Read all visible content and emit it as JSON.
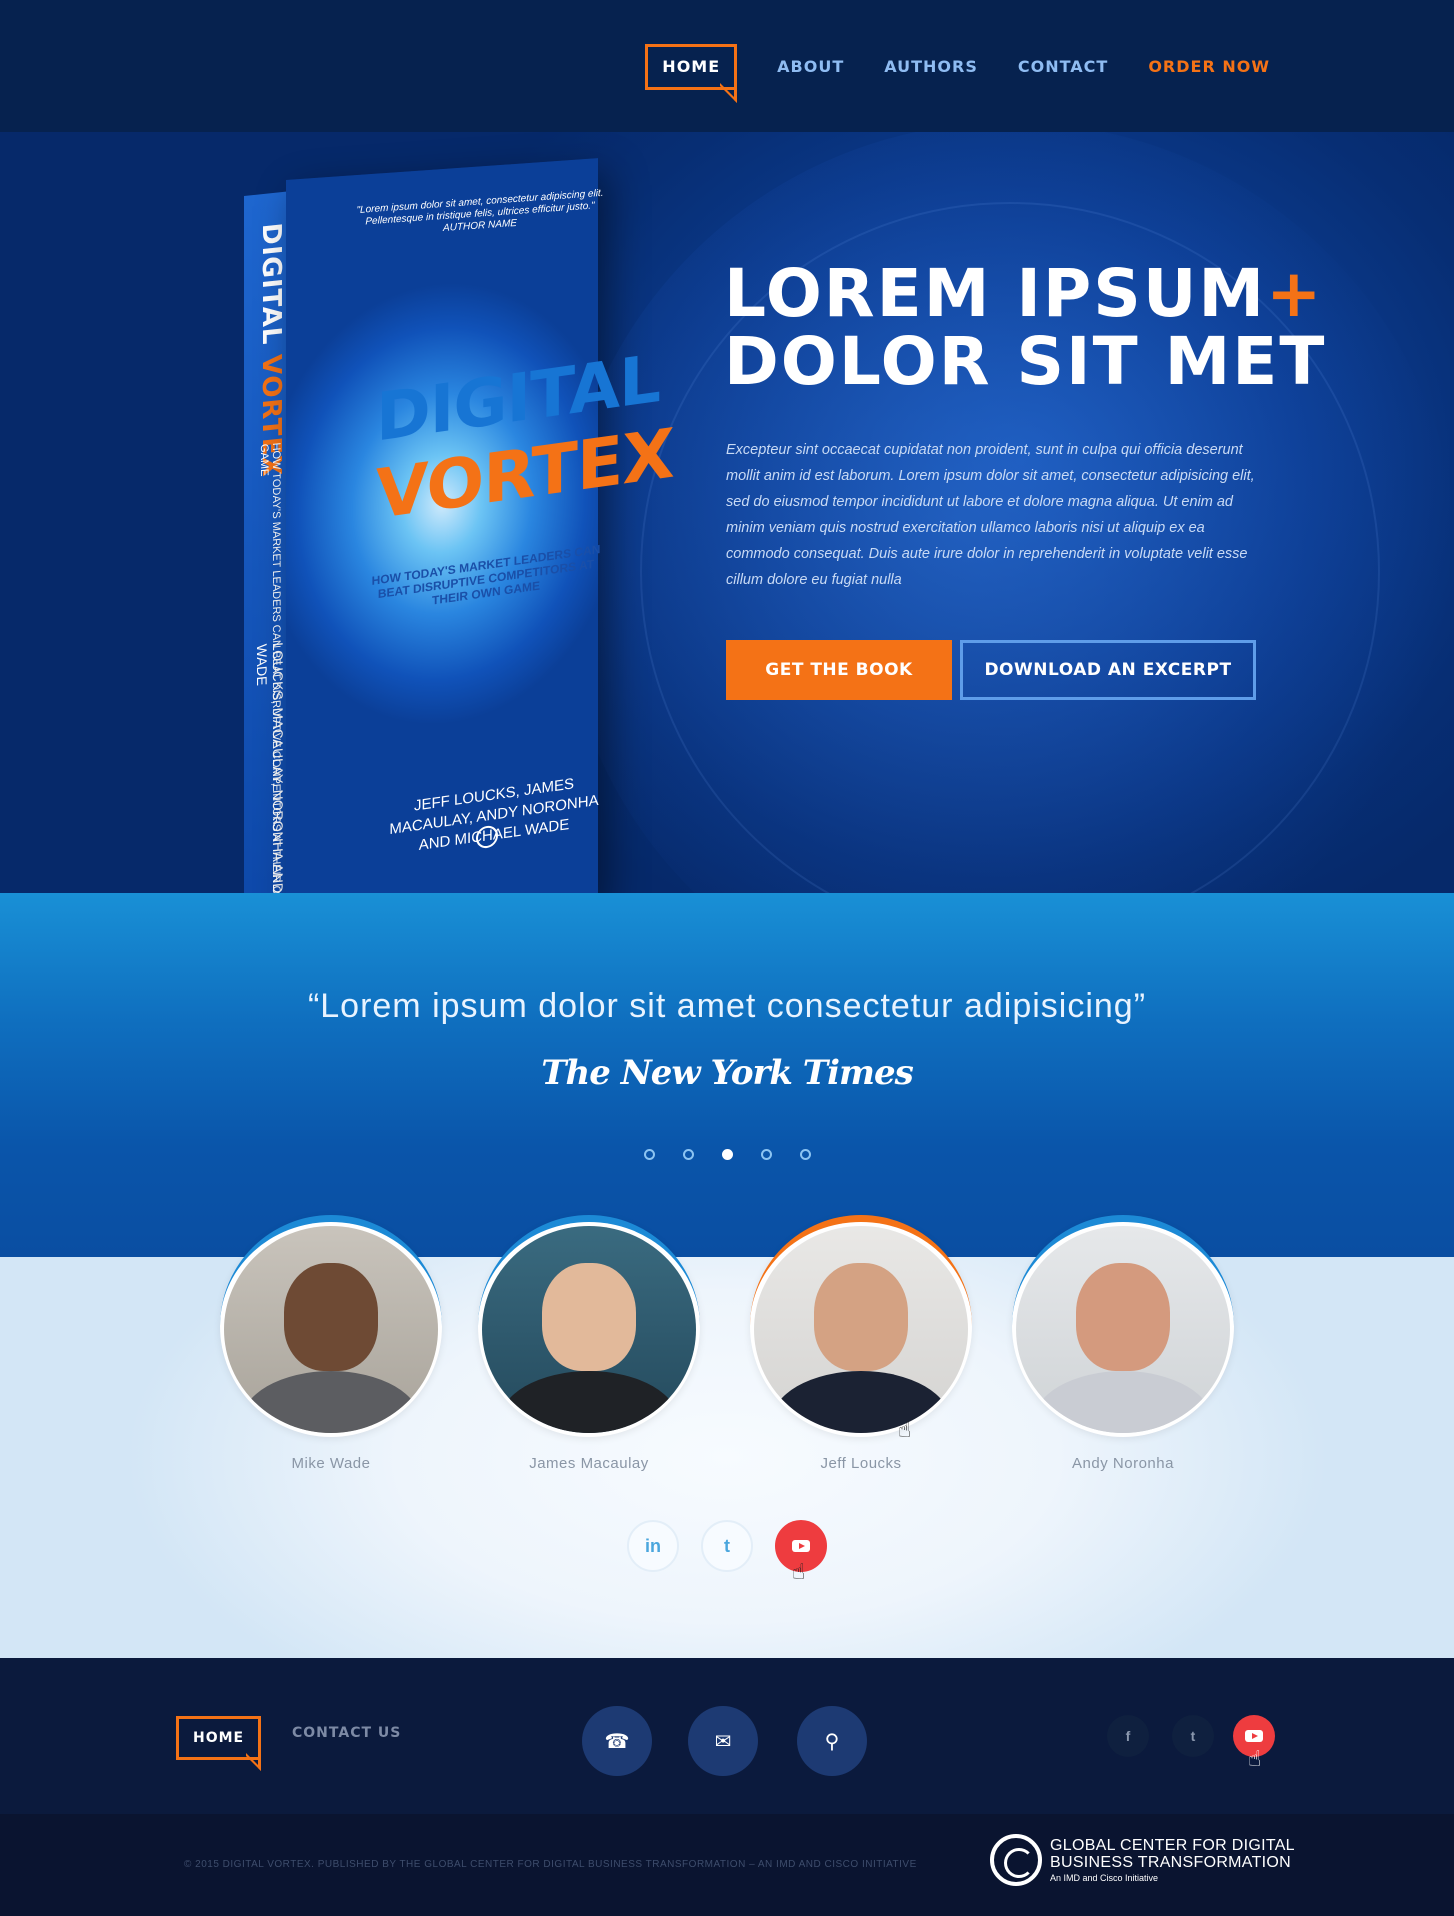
{
  "nav": {
    "home": "HOME",
    "about": "ABOUT",
    "authors": "AUTHORS",
    "contact": "CONTACT",
    "order": "ORDER NOW"
  },
  "book": {
    "spine_title_1": "DIGITAL",
    "spine_title_2": "VORTEX",
    "spine_subtitle": "HOW TODAY'S MARKET LEADERS CAN BEAT DISRUPTIVE COMPETITORS AT THEIR OWN GAME",
    "spine_authors": "LOUCKS, MACAULAY, NORONHA AND WADE",
    "cover_quote": "\"Lorem ipsum dolor sit amet, consectetur adipiscing elit. Pellentesque in tristique felis, ultrices efficitur justo.\" AUTHOR NAME",
    "title_1": "DIGITAL",
    "title_2": "VORTEX",
    "subtitle": "HOW TODAY'S MARKET LEADERS CAN BEAT DISRUPTIVE COMPETITORS AT THEIR OWN GAME",
    "authors": "JEFF LOUCKS, JAMES MACAULAY, ANDY NORONHA AND MICHAEL WADE"
  },
  "hero": {
    "title_line1": "LOREM IPSUM",
    "title_plus": "+",
    "title_line2": "DOLOR SIT MET",
    "text": "Excepteur sint occaecat cupidatat non proident, sunt in culpa qui officia deserunt mollit anim id est laborum. Lorem ipsum dolor sit amet, consectetur adipisicing elit, sed do eiusmod tempor incididunt ut labore et dolore magna aliqua. Ut enim ad minim veniam quis nostrud exercitation ullamco laboris nisi ut aliquip ex ea commodo consequat. Duis aute irure dolor in reprehenderit in voluptate velit esse cillum dolore eu fugiat nulla",
    "btn_primary": "GET THE BOOK",
    "btn_secondary": "DOWNLOAD AN EXCERPT"
  },
  "testimonial": {
    "quote": "“Lorem ipsum dolor sit amet consectetur adipisicing”",
    "source": "The New York Times",
    "slides": 5,
    "active_slide": 3
  },
  "authors": [
    {
      "name": "Mike Wade",
      "ring_color": "#1c8ad6"
    },
    {
      "name": "James Macaulay",
      "ring_color": "#1c8ad6"
    },
    {
      "name": "Jeff Loucks",
      "ring_color": "#f47216"
    },
    {
      "name": "Andy Noronha",
      "ring_color": "#1c8ad6"
    }
  ],
  "socials": {
    "linkedin": "in",
    "twitter": "t",
    "youtube": "youtube-icon"
  },
  "footer": {
    "home": "HOME",
    "contact": "CONTACT US",
    "copyright": "© 2015 DIGITAL VORTEX. PUBLISHED BY THE GLOBAL CENTER FOR DIGITAL BUSINESS TRANSFORMATION – AN IMD AND CISCO INITIATIVE",
    "logo_line1": "GLOBAL CENTER FOR DIGITAL",
    "logo_line2": "BUSINESS TRANSFORMATION",
    "logo_line3": "An IMD and Cisco Initiative",
    "social_f": "f",
    "social_t": "t"
  },
  "colors": {
    "accent": "#f47216",
    "header_bg": "#06224f",
    "youtube_red": "#ee3c3f"
  }
}
